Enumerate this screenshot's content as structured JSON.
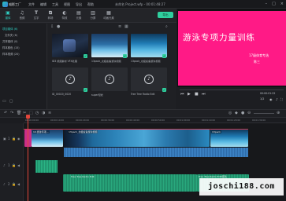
{
  "app": {
    "logo_text": "喵影工厂",
    "menu": [
      "文件",
      "编辑",
      "工具",
      "视图",
      "导出",
      "帮助"
    ],
    "project_title": "未命名 Project.wfp - 00:01:48:27"
  },
  "tabs": [
    {
      "label": "媒体",
      "icon": "folder-icon"
    },
    {
      "label": "音频",
      "icon": "music-icon"
    },
    {
      "label": "文字",
      "icon": "text-icon"
    },
    {
      "label": "转场",
      "icon": "transition-icon"
    },
    {
      "label": "特效",
      "icon": "effects-icon"
    },
    {
      "label": "元素",
      "icon": "elements-icon"
    },
    {
      "label": "分屏",
      "icon": "splitscreen-icon"
    },
    {
      "label": "动画元素",
      "icon": "animation-icon"
    }
  ],
  "export_label": "导出",
  "sidebar": [
    {
      "label": "项目媒体 (6)",
      "active": true
    },
    {
      "label": "文件夹 (6)",
      "active": false
    },
    {
      "label": "共享媒体 (0)",
      "active": false
    },
    {
      "label": "样本颜色 (15)",
      "active": false
    },
    {
      "label": "样本视频 (20)",
      "active": false
    }
  ],
  "media": [
    {
      "label": "ID3 视频素材 VFX处理",
      "kind": "video"
    },
    {
      "label": "13pack_北极鲨鱼游泳视频",
      "kind": "video"
    },
    {
      "label": "13pack_北极鲨鱼游泳视频",
      "kind": "video"
    },
    {
      "label": "ID_00020_0020",
      "kind": "audio"
    },
    {
      "label": "super轻松",
      "kind": "audio"
    },
    {
      "label": "Tree Tree Radio Edit",
      "kind": "audio"
    }
  ],
  "preview": {
    "title": "游泳专项力量训练",
    "subtitle1": "17级体育专选",
    "subtitle2": "陈三",
    "background_color": "#ff1a86",
    "timecode": "00:00:01:22",
    "ratio": "1/2"
  },
  "timeline": {
    "ruler_ticks": [
      "00:00:00:00",
      "00:00:10:00",
      "00:00:20:00",
      "00:00:30:00",
      "00:00:40:00",
      "00:00:50:00",
      "00:01:00:00",
      "00:01:10:00",
      "00:01:20:00",
      "00:01:30:00"
    ],
    "video_clips": [
      "10.游泳专项...",
      "13pack_北极鲨鱼游泳视频",
      "13pack"
    ],
    "audio_clip1": "Tree Tree Radio Edit",
    "audio_clip2": "Tree Tree Radio Edit音轨",
    "track_numbers": [
      "1",
      "1",
      "2"
    ]
  },
  "watermark": "joschi188.com"
}
